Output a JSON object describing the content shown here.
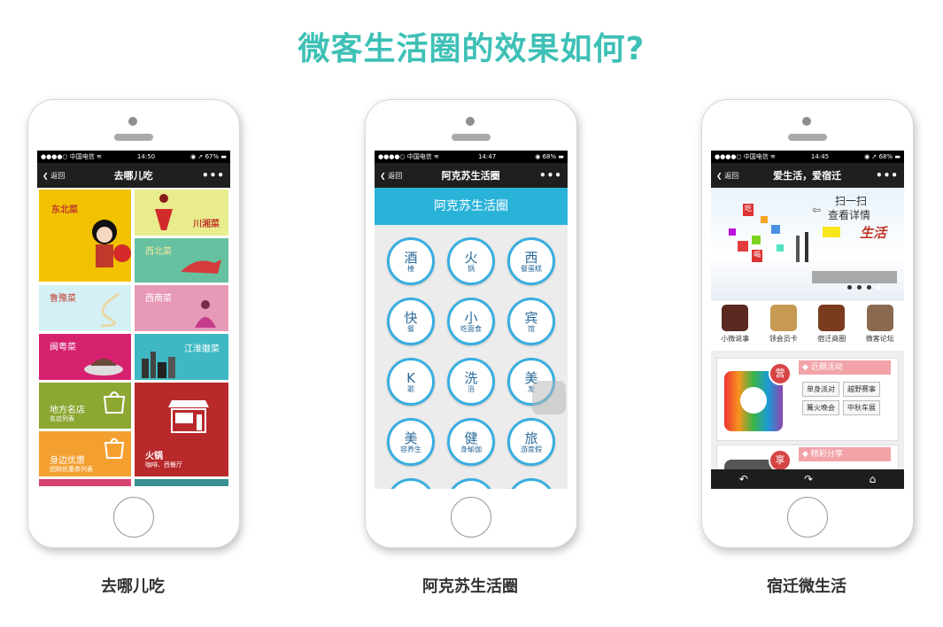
{
  "page": {
    "title": "微客生活圈的效果如何?"
  },
  "phones": [
    {
      "caption": "去哪儿吃",
      "status": {
        "carrier": "●●●●○ 中国电信 ≋",
        "time": "14:50",
        "right": "◉ ➚ 67% ▬"
      },
      "nav": {
        "back": "返回",
        "title": "去哪儿吃",
        "more": "•••"
      },
      "tiles": [
        {
          "label": "东北菜",
          "color": "#f2c200",
          "text_color": "#c0392b"
        },
        {
          "label": "川湘菜",
          "color": "#e9ec8c",
          "text_color": "#c0392b"
        },
        {
          "label": "西北菜",
          "color": "#66c1a0",
          "text_color": "#f7e9a0"
        },
        {
          "label": "鲁豫菜",
          "color": "#d5f0f5",
          "text_color": "#c0392b"
        },
        {
          "label": "西南菜",
          "color": "#e79ab7",
          "text_color": "#ffffff"
        },
        {
          "label": "闽粤菜",
          "color": "#d6216f",
          "text_color": "#ffffff"
        },
        {
          "label": "江淮徽菜",
          "color": "#3fb8c4",
          "text_color": "#ffffff"
        },
        {
          "label": "地方名店",
          "sub": "名店列表",
          "color": "#8ca833",
          "text_color": "#ffffff"
        },
        {
          "label": "火锅",
          "sub": "咖啡、西餐厅",
          "color": "#b8292b",
          "text_color": "#ffffff"
        },
        {
          "label": "身边优惠",
          "sub": "团购优惠券列表",
          "color": "#f3a031",
          "text_color": "#ffffff"
        }
      ]
    },
    {
      "caption": "阿克苏生活圈",
      "status": {
        "carrier": "●●●●○ 中国电信 ≋",
        "time": "14:47",
        "right": "◉ 68% ▬"
      },
      "nav": {
        "back": "返回",
        "title": "阿克苏生活圈",
        "more": "•••"
      },
      "header": "阿克苏生活圈",
      "circles": [
        {
          "big": "酒",
          "small": "楼"
        },
        {
          "big": "火",
          "small": "锅"
        },
        {
          "big": "西",
          "small": "餐蛋糕"
        },
        {
          "big": "快",
          "small": "餐"
        },
        {
          "big": "小",
          "small": "吃面食"
        },
        {
          "big": "宾",
          "small": "馆"
        },
        {
          "big": "K",
          "small": "歌"
        },
        {
          "big": "洗",
          "small": "浴"
        },
        {
          "big": "美",
          "small": "发"
        },
        {
          "big": "美",
          "small": "容养生"
        },
        {
          "big": "健",
          "small": "身瑜伽"
        },
        {
          "big": "旅",
          "small": "游度假"
        }
      ]
    },
    {
      "caption": "宿迁微生活",
      "status": {
        "carrier": "●●●●○ 中国电信 ≋",
        "time": "14:45",
        "right": "◉ ➚ 68% ▬"
      },
      "nav": {
        "back": "返回",
        "title": "爱生活，爱宿迁",
        "more": "•••"
      },
      "banner": {
        "scan": "扫一扫",
        "details": "查看详情",
        "brand": "生活",
        "words": [
          "吃",
          "喝"
        ]
      },
      "icons": [
        {
          "label": "小微说事",
          "color": "#5a2a20"
        },
        {
          "label": "领会员卡",
          "color": "#c69a52"
        },
        {
          "label": "宿迁商圈",
          "color": "#7a3b1f"
        },
        {
          "label": "微客论坛",
          "color": "#8a6a4f"
        }
      ],
      "activity": {
        "title": "近期活动",
        "badge": "营",
        "tags": [
          "单身派对",
          "越野赛事",
          "篝火晚会",
          "中秋车展"
        ]
      },
      "share": {
        "title": "精彩分享",
        "badge": "享"
      },
      "tabbar": {
        "back": "↶",
        "forward": "↷",
        "home": "⌂"
      }
    }
  ]
}
